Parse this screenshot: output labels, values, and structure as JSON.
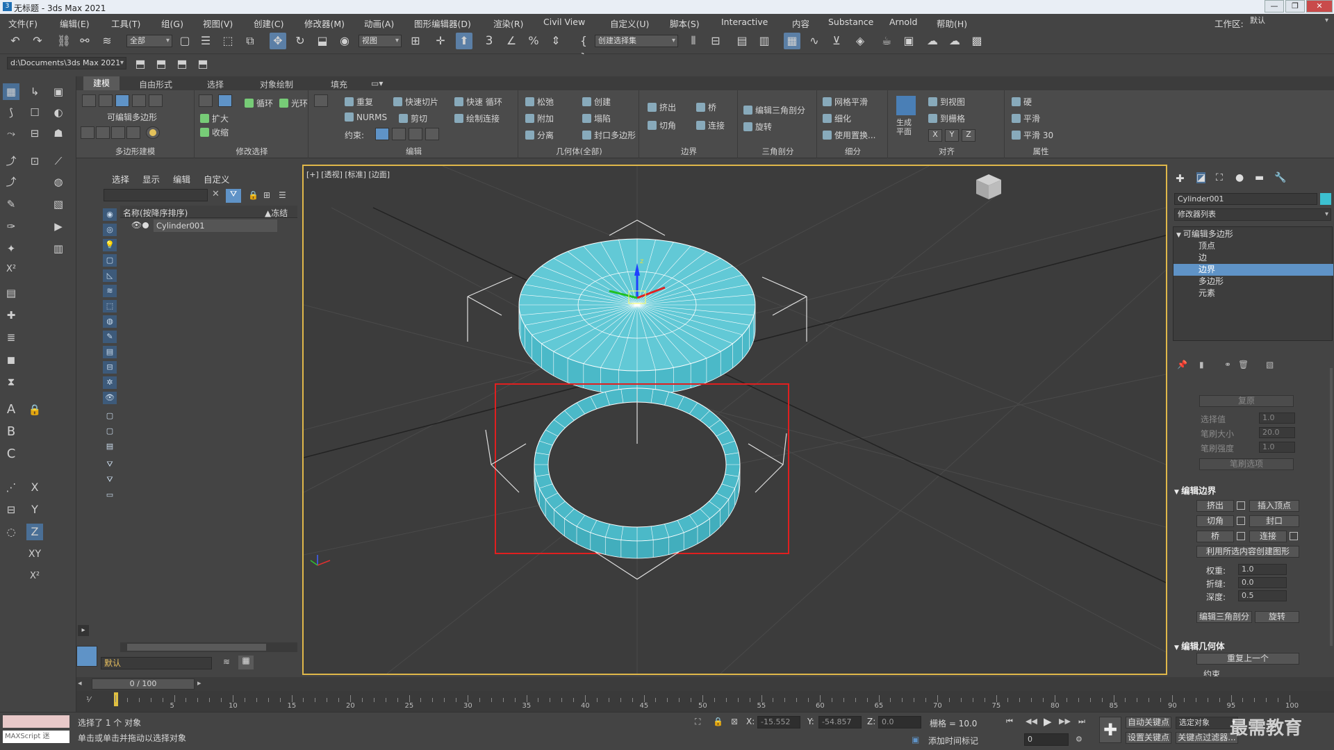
{
  "window": {
    "title": "无标题 - 3ds Max 2021",
    "app_icon": "3"
  },
  "menu": [
    "文件(F)",
    "编辑(E)",
    "工具(T)",
    "组(G)",
    "视图(V)",
    "创建(C)",
    "修改器(M)",
    "动画(A)",
    "图形编辑器(D)",
    "渲染(R)",
    "Civil View",
    "自定义(U)",
    "脚本(S)",
    "Interactive",
    "内容",
    "Substance",
    "Arnold",
    "帮助(H)"
  ],
  "workspace": {
    "label": "工作区:",
    "value": "默认"
  },
  "toolbar": {
    "filter_dropdown": "全部",
    "refcoord_dropdown": "视图",
    "selset_dropdown": "创建选择集",
    "snap_label": "3"
  },
  "pathbar": {
    "project_path": "d:\\Documents\\3ds Max 2021"
  },
  "ribbon": {
    "tabs": [
      "建模",
      "自由形式",
      "选择",
      "对象绘制",
      "填充"
    ],
    "groups": {
      "poly": {
        "title": "可编辑多边形",
        "label": "多边形建模"
      },
      "modsel": {
        "label": "修改选择",
        "grow": "扩大",
        "shrink": "收缩",
        "loop": "循环",
        "ring": "光环"
      },
      "edit": {
        "label": "编辑",
        "repeat": "重复",
        "quickslice": "快速切片",
        "quickloop": "快速 循环",
        "nurms": "NURMS",
        "cut": "剪切",
        "swiftloop": "绘制连接",
        "constraint": "约束:"
      },
      "geometry": {
        "label": "几何体(全部)",
        "relax": "松弛",
        "create": "创建",
        "attach": "附加",
        "collapse": "塌陷",
        "detach": "分离",
        "cap": "封口多边形"
      },
      "border": {
        "label": "边界",
        "extrude": "挤出",
        "bridge": "桥",
        "chamfer": "切角",
        "connect": "连接"
      },
      "tri": {
        "label": "三角剖分",
        "edit_tri": "编辑三角剖分",
        "rotate": "旋转"
      },
      "subdiv": {
        "label": "细分",
        "meshsmooth": "网格平滑",
        "tessellate": "细化",
        "use_displace": "使用置换..."
      },
      "align": {
        "label": "对齐",
        "make_planar": "生成\n平面",
        "to_view": "到视图",
        "to_grid": "到栅格",
        "x": "X",
        "y": "Y",
        "z": "Z"
      },
      "props": {
        "label": "属性",
        "hard": "硬",
        "smooth": "平滑",
        "smooth30": "平滑 30"
      }
    }
  },
  "explorer": {
    "menu": [
      "选择",
      "显示",
      "编辑",
      "自定义"
    ],
    "col_name": "名称(按降序排序)",
    "col_frozen": "▲冻结",
    "objects": [
      "Cylinder001"
    ],
    "layer": "默认"
  },
  "viewport": {
    "label": "[+] [透视] [标准] [边面]",
    "gizmo_z": "z"
  },
  "cmdpanel": {
    "object_name": "Cylinder001",
    "object_color": "#3cc0d0",
    "modifier_list": "修改器列表",
    "stack": [
      "可编辑多边形",
      "顶点",
      "边",
      "边界",
      "多边形",
      "元素"
    ],
    "stack_selected": "边界",
    "soft": {
      "restore": "复原",
      "sel_value_label": "选择值",
      "sel_value": "1.0",
      "brush_size_label": "笔刷大小",
      "brush_size": "20.0",
      "brush_strength_label": "笔刷强度",
      "brush_strength": "1.0",
      "brush_options": "笔刷选项"
    },
    "edit_border": {
      "title": "编辑边界",
      "extrude": "挤出",
      "insert_vertex": "插入顶点",
      "chamfer": "切角",
      "cap": "封口",
      "bridge": "桥",
      "connect": "连接",
      "create_shape": "利用所选内容创建图形",
      "weight_label": "权重:",
      "weight": "1.0",
      "crease_label": "折缝:",
      "crease": "0.0",
      "depth_label": "深度:",
      "depth": "0.5",
      "edit_tri": "编辑三角剖分",
      "turn": "旋转"
    },
    "edit_geometry": {
      "title": "编辑几何体",
      "repeat_last": "重复上一个",
      "constraints": "约束"
    }
  },
  "timeline": {
    "frame_counter": "0 / 100",
    "ticks": [
      5,
      10,
      15,
      20,
      25,
      30,
      35,
      40,
      45,
      50,
      55,
      60,
      65,
      70,
      75,
      80,
      85,
      90,
      95,
      100
    ]
  },
  "status": {
    "maxscript": "MAXScript 迷",
    "selected": "选择了 1 个 对象",
    "prompt": "单击或单击并拖动以选择对象",
    "x_label": "X:",
    "x": "-15.552",
    "y_label": "Y:",
    "y": "-54.857",
    "z_label": "Z:",
    "z": "0.0",
    "grid": "栅格 = 10.0",
    "add_time_tag": "添加时间标记",
    "auto_key": "自动关键点",
    "set_key": "设置关键点",
    "selected_object": "选定对象",
    "key_filter": "关键点过滤器...",
    "frame": "0",
    "watermark": "最需教育"
  }
}
